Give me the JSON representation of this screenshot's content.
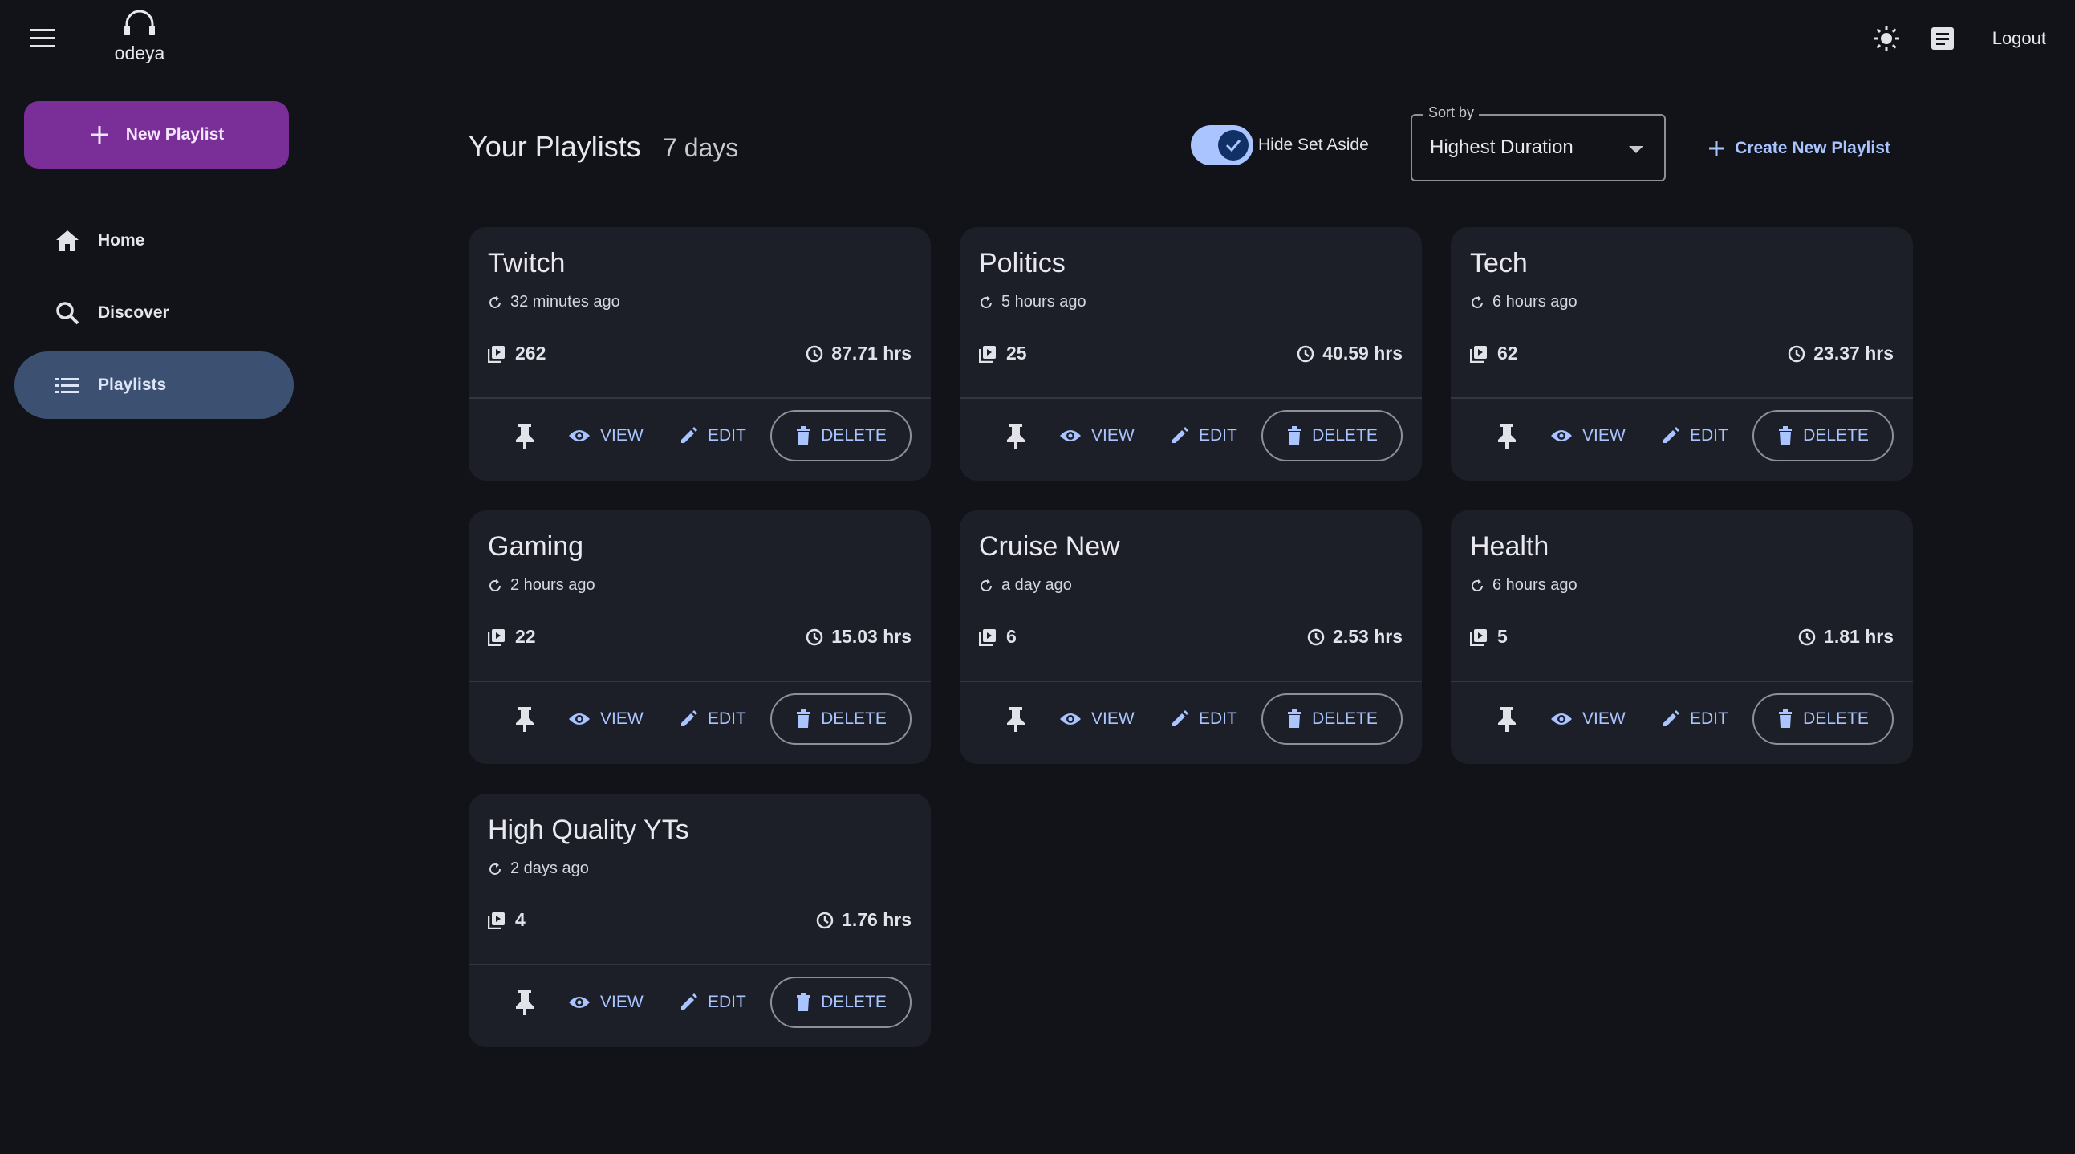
{
  "app": {
    "name": "odeya"
  },
  "topbar": {
    "logout_label": "Logout",
    "icons": [
      "menu-icon",
      "headphones-icon",
      "sun-icon",
      "notes-icon"
    ]
  },
  "sidebar": {
    "new_playlist_label": "New Playlist",
    "items": [
      {
        "label": "Home",
        "icon": "home-icon",
        "active": false
      },
      {
        "label": "Discover",
        "icon": "search-icon",
        "active": false
      },
      {
        "label": "Playlists",
        "icon": "list-icon",
        "active": true
      }
    ]
  },
  "header": {
    "title": "Your Playlists",
    "subtitle": "7 days",
    "toggle_label": "Hide Set Aside",
    "toggle_on": true,
    "sort_legend": "Sort by",
    "sort_value": "Highest Duration",
    "create_label": "Create New Playlist"
  },
  "actions": {
    "view": "VIEW",
    "edit": "EDIT",
    "delete": "DELETE"
  },
  "colors": {
    "background": "#111318",
    "card": "#1c1f27",
    "accent": "#a9c4ff",
    "primary_button": "#7a2e97",
    "active_nav": "#3c5172"
  },
  "playlists": [
    {
      "title": "Twitch",
      "updated": "32 minutes ago",
      "count": "262",
      "duration": "87.71 hrs"
    },
    {
      "title": "Politics",
      "updated": "5 hours ago",
      "count": "25",
      "duration": "40.59 hrs"
    },
    {
      "title": "Tech",
      "updated": "6 hours ago",
      "count": "62",
      "duration": "23.37 hrs"
    },
    {
      "title": "Gaming",
      "updated": "2 hours ago",
      "count": "22",
      "duration": "15.03 hrs"
    },
    {
      "title": "Cruise New",
      "updated": "a day ago",
      "count": "6",
      "duration": "2.53 hrs"
    },
    {
      "title": "Health",
      "updated": "6 hours ago",
      "count": "5",
      "duration": "1.81 hrs"
    },
    {
      "title": "High Quality YTs",
      "updated": "2 days ago",
      "count": "4",
      "duration": "1.76 hrs"
    }
  ]
}
